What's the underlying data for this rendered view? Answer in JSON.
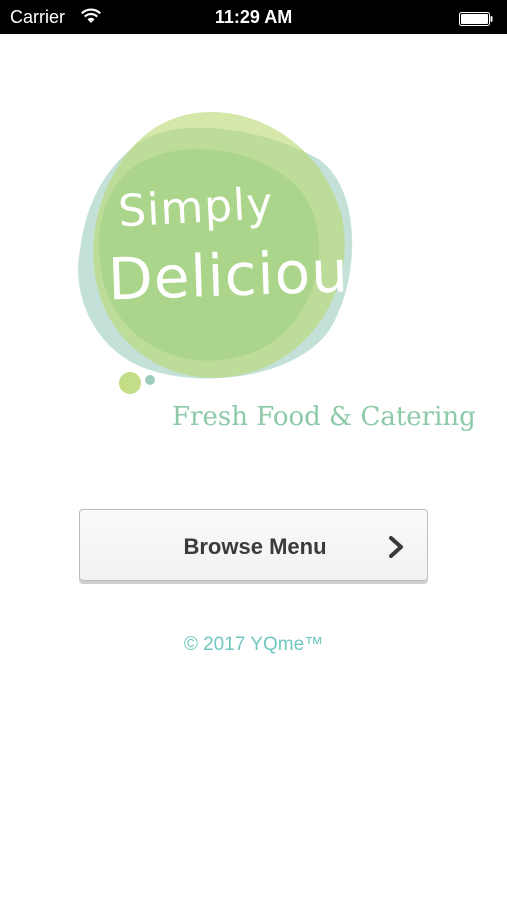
{
  "status_bar": {
    "carrier": "Carrier",
    "time": "11:29 AM",
    "wifi_icon": "wifi-icon",
    "battery_icon": "battery-full-icon"
  },
  "logo": {
    "line1": "Simply",
    "line2": "Delicious",
    "colors": [
      "#b9d872",
      "#92c8b8",
      "#9ccf7d"
    ]
  },
  "tagline": "Fresh Food & Catering",
  "browse_button": {
    "label": "Browse Menu",
    "icon": "chevron-right-icon"
  },
  "footer": {
    "copyright": "© 2017 YQme™"
  },
  "colors": {
    "accent": "#6fc7bf",
    "tagline": "#8ccaa9",
    "button_text": "#3a3a3a"
  }
}
